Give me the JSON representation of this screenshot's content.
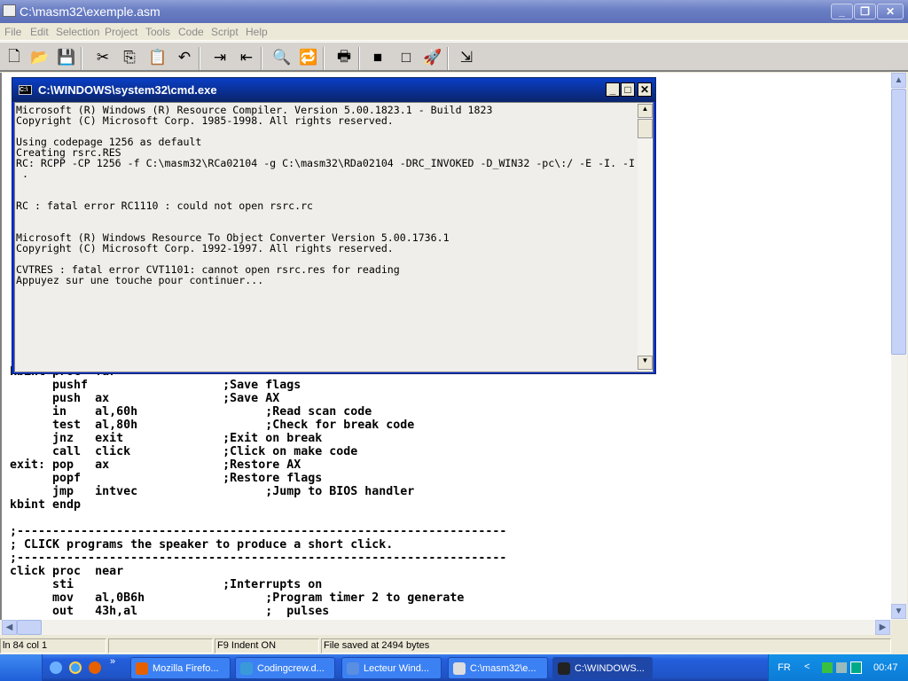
{
  "window": {
    "title": "C:\\masm32\\exemple.asm",
    "minimize": "_",
    "restore": "❐",
    "close": "✕"
  },
  "menu": [
    "File",
    "Edit",
    "Selection",
    "Project",
    "Tools",
    "Code",
    "Script",
    "Help"
  ],
  "toolbar": [
    {
      "icon": "new-file-icon",
      "glyph": "🗋"
    },
    {
      "icon": "open-folder-icon",
      "glyph": "📂"
    },
    {
      "icon": "save-icon",
      "glyph": "💾"
    },
    {
      "icon": "cut-icon",
      "glyph": "✂"
    },
    {
      "icon": "copy-icon",
      "glyph": "⎘"
    },
    {
      "icon": "paste-icon",
      "glyph": "📋"
    },
    {
      "icon": "undo-icon",
      "glyph": "↶"
    },
    {
      "icon": "indent-icon",
      "glyph": "⇥"
    },
    {
      "icon": "outdent-icon",
      "glyph": "⇤"
    },
    {
      "icon": "find-icon",
      "glyph": "🔍"
    },
    {
      "icon": "replace-icon",
      "glyph": "🔁"
    },
    {
      "icon": "print-icon",
      "glyph": "🖶"
    },
    {
      "icon": "console-icon",
      "glyph": "■"
    },
    {
      "icon": "window-icon",
      "glyph": "□"
    },
    {
      "icon": "run-icon",
      "glyph": "🚀"
    },
    {
      "icon": "exit-icon",
      "glyph": "⇲"
    }
  ],
  "editor": {
    "lines": [
      "kbint proc  far",
      "      pushf                   ;Save flags",
      "      push  ax                ;Save AX",
      "      in    al,60h                  ;Read scan code",
      "      test  al,80h                  ;Check for break code",
      "      jnz   exit              ;Exit on break",
      "      call  click             ;Click on make code",
      "exit: pop   ax                ;Restore AX",
      "      popf                    ;Restore flags",
      "      jmp   intvec                  ;Jump to BIOS handler",
      "kbint endp",
      "",
      ";---------------------------------------------------------------------",
      "; CLICK programs the speaker to produce a short click.",
      ";---------------------------------------------------------------------",
      "click proc  near",
      "      sti                     ;Interrupts on",
      "      mov   al,0B6h                 ;Program timer 2 to generate",
      "      out   43h,al                  ;  pulses"
    ]
  },
  "cmd": {
    "title": "C:\\WINDOWS\\system32\\cmd.exe",
    "icon_text": "C:\\",
    "lines": [
      "Microsoft (R) Windows (R) Resource Compiler. Version 5.00.1823.1 - Build 1823",
      "Copyright (C) Microsoft Corp. 1985-1998. All rights reserved.",
      "",
      "Using codepage 1256 as default",
      "Creating rsrc.RES",
      "RC: RCPP -CP 1256 -f C:\\masm32\\RCa02104 -g C:\\masm32\\RDa02104 -DRC_INVOKED -D_WIN32 -pc\\:/ -E -I. -I",
      " .",
      "",
      "",
      "RC : fatal error RC1110 : could not open rsrc.rc",
      "",
      "",
      "Microsoft (R) Windows Resource To Object Converter Version 5.00.1736.1",
      "Copyright (C) Microsoft Corp. 1992-1997. All rights reserved.",
      "",
      "CVTRES : fatal error CVT1101: cannot open rsrc.res for reading",
      "Appuyez sur une touche pour continuer..."
    ]
  },
  "status": {
    "position": "ln 84 col 1",
    "empty": "",
    "indent": "F9 Indent ON",
    "saved": "File saved at  2494 bytes"
  },
  "taskbar": {
    "tasks": [
      {
        "label": "Mozilla Firefo...",
        "color": "#e66000"
      },
      {
        "label": "Codingcrew.d...",
        "color": "#3a9ad9"
      },
      {
        "label": "Lecteur Wind...",
        "color": "#5a8ee0"
      },
      {
        "label": "C:\\masm32\\e...",
        "color": "#dddddd"
      },
      {
        "label": "C:\\WINDOWS...",
        "color": "#222222",
        "active": true
      }
    ],
    "lang": "FR",
    "tray_arrow": "<",
    "clock": "00:47"
  }
}
